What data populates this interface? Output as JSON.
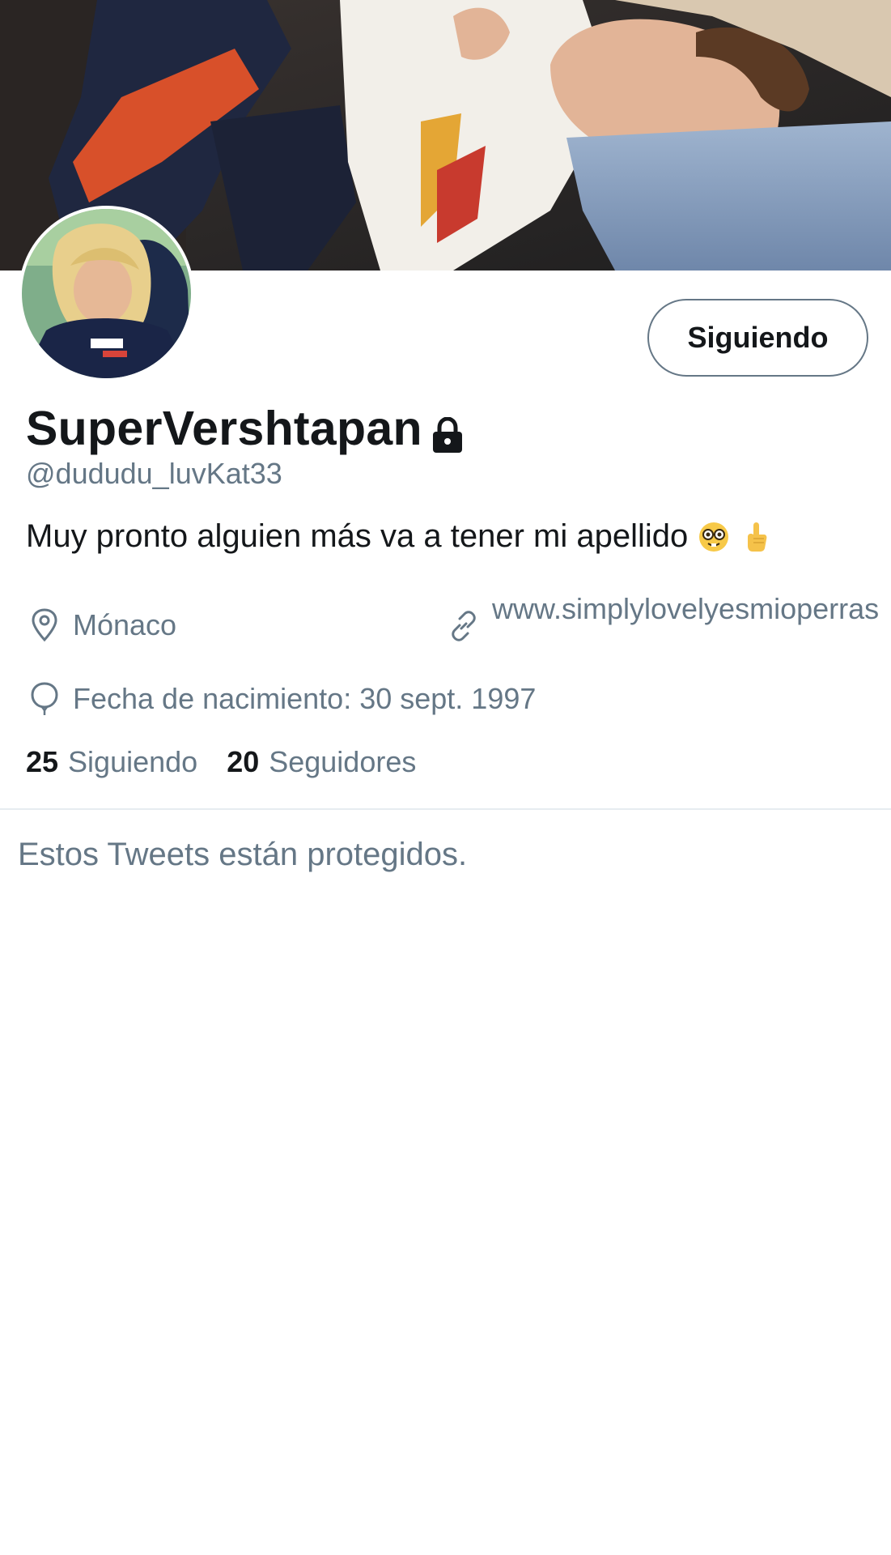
{
  "profile": {
    "display_name": "SuperVershtapan",
    "handle": "@dududu_luvKat33",
    "bio": "Muy pronto alguien más va a tener mi apellido",
    "bio_emojis": [
      "nerd-face-emoji",
      "pointing-up-emoji"
    ],
    "location": "Mónaco",
    "website": "www.simplylovelyesmioperras",
    "birth": "Fecha de nacimiento: 30 sept. 1997",
    "following_count": "25",
    "following_label": "Siguiendo",
    "followers_count": "20",
    "followers_label": "Seguidores",
    "protected_account": true
  },
  "actions": {
    "follow_button_label": "Siguiendo"
  },
  "timeline": {
    "protected_message": "Estos Tweets están protegidos."
  },
  "icons": {
    "lock": "lock-icon",
    "location": "location-pin-icon",
    "link": "link-icon",
    "birth": "balloon-icon"
  },
  "colors": {
    "text_primary": "#14171a",
    "text_secondary": "#657786",
    "divider": "#e6ecf0",
    "background": "#ffffff"
  }
}
